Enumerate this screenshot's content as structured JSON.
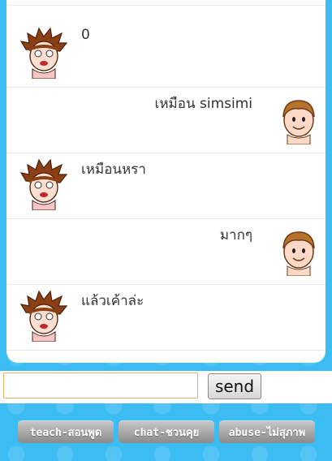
{
  "conversation": {
    "messages": [
      {
        "side": "left",
        "speaker": "sim-boy",
        "text": "0"
      },
      {
        "side": "right",
        "speaker": "user-boy",
        "text": "เหมือน simsimi"
      },
      {
        "side": "left",
        "speaker": "sim-boy",
        "text": "เหมือนหรา"
      },
      {
        "side": "right",
        "speaker": "user-boy",
        "text": "มากๆ"
      },
      {
        "side": "left",
        "speaker": "sim-boy",
        "text": "แล้วเค้าล่ะ"
      }
    ]
  },
  "composer": {
    "input_value": "",
    "send_label": "send"
  },
  "actions": {
    "teach_label": "teach-สอนพูด",
    "chat_label": "chat-ชวนคุย",
    "abuse_label": "abuse-ไม่สุภาพ"
  },
  "colors": {
    "background": "#3bbcf3",
    "panel": "#ffffff",
    "button": "#a8a8a8"
  }
}
